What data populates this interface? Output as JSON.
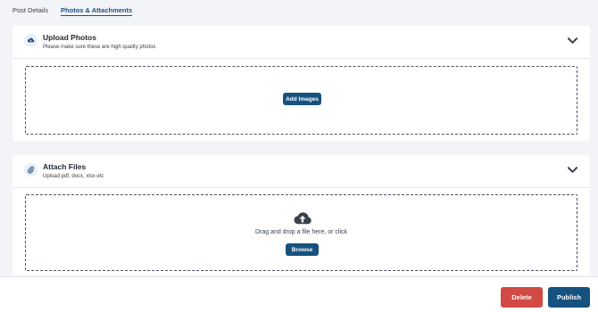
{
  "tabs": [
    {
      "label": "Post Details",
      "active": false
    },
    {
      "label": "Photos & Attachments",
      "active": true
    }
  ],
  "upload_photos": {
    "title": "Upload Photos",
    "subtitle": "Please make sure these are high quality photos",
    "icon": "cloud-upload-icon",
    "button_label": "Add Images"
  },
  "attach_files": {
    "title": "Attach Files",
    "subtitle": "Upload pdf, docx, xlsx etc",
    "icon": "paperclip-icon",
    "drop_text": "Drag and drop a file here, or click",
    "button_label": "Browse"
  },
  "footer": {
    "delete_label": "Delete",
    "publish_label": "Publish"
  },
  "colors": {
    "accent": "#16527f",
    "danger": "#d14a44",
    "tab_active": "#1b4f86"
  }
}
